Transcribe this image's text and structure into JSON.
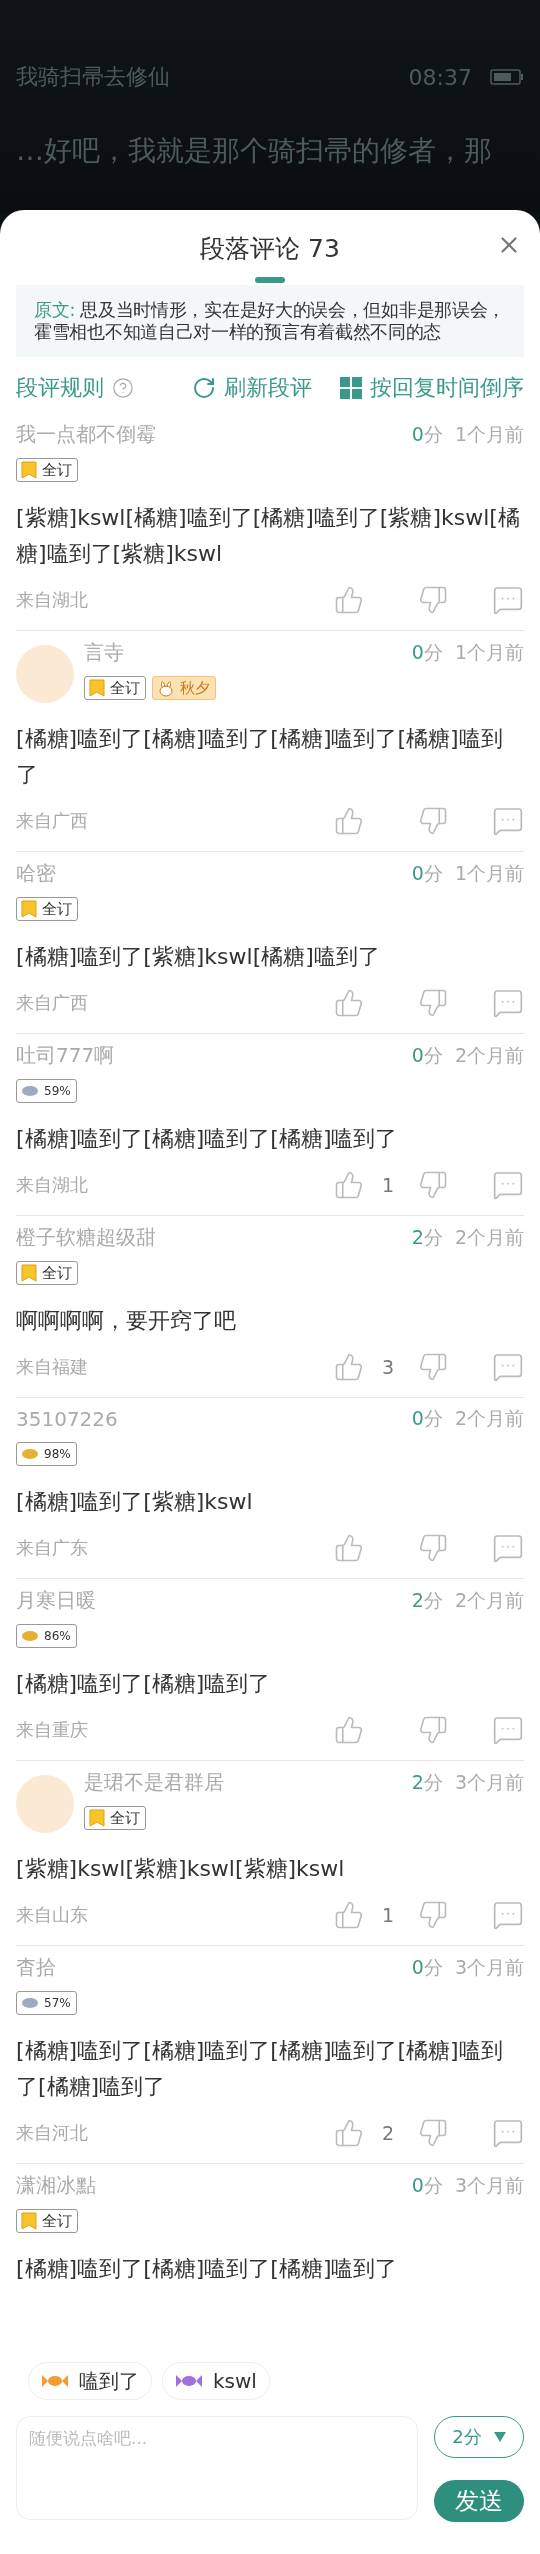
{
  "reader": {
    "book_title": "我骑扫帚去修仙",
    "time": "08:37",
    "text": "…好吧，我就是那个骑扫帚的修者，那"
  },
  "sheet": {
    "title": "段落评论",
    "count": "73",
    "quote_label": "原文:",
    "quote": "思及当时情形，实在是好大的误会，但如非是那误会，霍雪相也不知道自己对一样的预言有着截然不同的态",
    "rules": "段评规则",
    "refresh": "刷新段评",
    "sort": "按回复时间倒序"
  },
  "comments": [
    {
      "user": "我一点都不倒霉",
      "avatar": false,
      "score": "0",
      "score_unit": "分",
      "time": "1个月前",
      "badges": [
        {
          "kind": "full",
          "label": "全订"
        }
      ],
      "text": "[紫糖]kswl[橘糖]嗑到了[橘糖]嗑到了[紫糖]kswl[橘糖]嗑到了[紫糖]kswl",
      "location": "来自湖北"
    },
    {
      "user": "言寺",
      "avatar": true,
      "score": "0",
      "score_unit": "分",
      "time": "1个月前",
      "badges": [
        {
          "kind": "full",
          "label": "全订"
        },
        {
          "kind": "fan",
          "label": "秋夕"
        }
      ],
      "text": "[橘糖]嗑到了[橘糖]嗑到了[橘糖]嗑到了[橘糖]嗑到了",
      "location": "来自广西"
    },
    {
      "user": "哈密",
      "avatar": false,
      "score": "0",
      "score_unit": "分",
      "time": "1个月前",
      "badges": [
        {
          "kind": "full",
          "label": "全订"
        }
      ],
      "text": "[橘糖]嗑到了[紫糖]kswl[橘糖]嗑到了",
      "location": "来自广西"
    },
    {
      "user": "吐司777啊",
      "avatar": false,
      "score": "0",
      "score_unit": "分",
      "time": "2个月前",
      "badges": [
        {
          "kind": "rate",
          "label": "59%",
          "color": "#9aaac0"
        }
      ],
      "text": "[橘糖]嗑到了[橘糖]嗑到了[橘糖]嗑到了",
      "location": "来自湖北",
      "likes": "1"
    },
    {
      "user": "橙子软糖超级甜",
      "avatar": false,
      "score": "2",
      "score_unit": "分",
      "time": "2个月前",
      "badges": [
        {
          "kind": "full",
          "label": "全订"
        }
      ],
      "text": "啊啊啊啊，要开窍了吧",
      "location": "来自福建",
      "likes": "3"
    },
    {
      "user": "35107226",
      "avatar": false,
      "score": "0",
      "score_unit": "分",
      "time": "2个月前",
      "badges": [
        {
          "kind": "rate",
          "label": "98%",
          "color": "#e8b030"
        }
      ],
      "text": "[橘糖]嗑到了[紫糖]kswl",
      "location": "来自广东"
    },
    {
      "user": "月寒日暖",
      "avatar": false,
      "score": "2",
      "score_unit": "分",
      "time": "2个月前",
      "badges": [
        {
          "kind": "rate",
          "label": "86%",
          "color": "#e8b030"
        }
      ],
      "text": "[橘糖]嗑到了[橘糖]嗑到了",
      "location": "来自重庆"
    },
    {
      "user": "是珺不是君群居",
      "avatar": true,
      "score": "2",
      "score_unit": "分",
      "time": "3个月前",
      "badges": [
        {
          "kind": "full",
          "label": "全订"
        }
      ],
      "text": "[紫糖]kswl[紫糖]kswl[紫糖]kswl",
      "location": "来自山东",
      "likes": "1"
    },
    {
      "user": "杳拾",
      "avatar": false,
      "score": "0",
      "score_unit": "分",
      "time": "3个月前",
      "badges": [
        {
          "kind": "rate",
          "label": "57%",
          "color": "#9aaac0"
        }
      ],
      "text": "[橘糖]嗑到了[橘糖]嗑到了[橘糖]嗑到了[橘糖]嗑到了[橘糖]嗑到了",
      "location": "来自河北",
      "likes": "2"
    },
    {
      "user": "潇湘冰點",
      "avatar": false,
      "score": "0",
      "score_unit": "分",
      "time": "3个月前",
      "badges": [
        {
          "kind": "full",
          "label": "全订"
        }
      ],
      "text": "[橘糖]嗑到了[橘糖]嗑到了[橘糖]嗑到了"
    }
  ],
  "composer": {
    "chips": [
      {
        "label": "嗑到了",
        "color": "#f39a30"
      },
      {
        "label": "kswl",
        "color": "#a070e0"
      }
    ],
    "placeholder": "随便说点啥吧...",
    "score_select": "2分",
    "send": "发送"
  }
}
